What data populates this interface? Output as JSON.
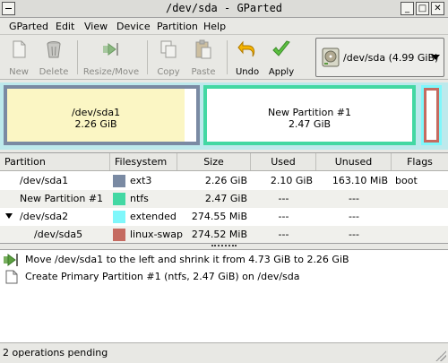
{
  "window": {
    "title": "/dev/sda - GParted",
    "buttons": [
      "_",
      "□",
      "✕"
    ]
  },
  "menubar": {
    "items": [
      "GParted",
      "Edit",
      "View",
      "Device",
      "Partition",
      "Help"
    ]
  },
  "toolbar": {
    "new": "New",
    "delete": "Delete",
    "resize_move": "Resize/Move",
    "copy": "Copy",
    "paste": "Paste",
    "undo": "Undo",
    "apply": "Apply"
  },
  "device_selector": {
    "value": "/dev/sda   (4.99 GiB)",
    "icon": "hard-disk-icon"
  },
  "partition_map": {
    "sda1": {
      "name": "/dev/sda1",
      "size": "2.26 GiB",
      "color": "#7a8aa3"
    },
    "new": {
      "name": "New Partition #1",
      "size": "2.47 GiB",
      "color": "#43d8a3"
    },
    "extended_color": "#7ff7fb",
    "swap_color": "#c56b61",
    "used_color": "#fbf6c4"
  },
  "table": {
    "headers": [
      "Partition",
      "Filesystem",
      "Size",
      "Used",
      "Unused",
      "Flags"
    ],
    "rows": [
      {
        "partition": "/dev/sda1",
        "filesystem": "ext3",
        "fs_color": "#7a8aa3",
        "size": "2.26 GiB",
        "used": "2.10 GiB",
        "unused": "163.10 MiB",
        "flags": "boot"
      },
      {
        "partition": "New Partition #1",
        "filesystem": "ntfs",
        "fs_color": "#43d8a3",
        "size": "2.47 GiB",
        "used": "---",
        "unused": "---",
        "flags": ""
      },
      {
        "partition": "/dev/sda2",
        "filesystem": "extended",
        "fs_color": "#7ff7fb",
        "size": "274.55 MiB",
        "used": "---",
        "unused": "---",
        "flags": ""
      },
      {
        "partition": "/dev/sda5",
        "filesystem": "linux-swap",
        "fs_color": "#c56b61",
        "size": "274.52 MiB",
        "used": "---",
        "unused": "---",
        "flags": ""
      }
    ]
  },
  "operations": [
    {
      "icon": "move-arrow-icon",
      "text": "Move /dev/sda1 to the left and shrink it from 4.73 GiB to 2.26 GiB"
    },
    {
      "icon": "document-icon",
      "text": "Create Primary Partition #1 (ntfs, 2.47 GiB) on /dev/sda"
    }
  ],
  "status": {
    "text": "2 operations pending"
  }
}
